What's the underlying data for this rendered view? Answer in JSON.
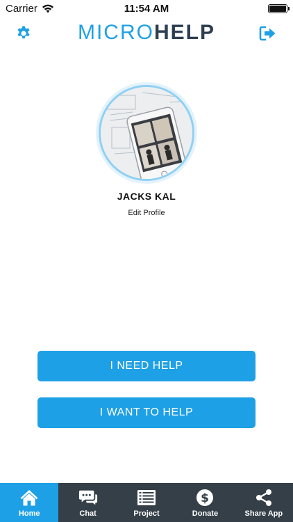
{
  "status_bar": {
    "carrier": "Carrier",
    "time": "11:54 AM",
    "battery_level": 1.0
  },
  "header": {
    "logo_part1": "MICRO",
    "logo_part2": "HELP",
    "left_icon": "gear-icon",
    "right_icon": "logout-icon"
  },
  "profile": {
    "name": "JACKS KAL",
    "edit_label": "Edit Profile"
  },
  "actions": {
    "need_help": "I NEED HELP",
    "want_help": "I WANT TO HELP"
  },
  "tabs": [
    {
      "label": "Home",
      "icon": "home-icon",
      "active": true
    },
    {
      "label": "Chat",
      "icon": "chat-icon",
      "active": false
    },
    {
      "label": "Project",
      "icon": "project-icon",
      "active": false
    },
    {
      "label": "Donate",
      "icon": "dollar-icon",
      "active": false
    },
    {
      "label": "Share App",
      "icon": "share-icon",
      "active": false
    }
  ],
  "colors": {
    "accent": "#1ea0e6",
    "tab_bar": "#343f47",
    "logo_dark": "#2c3e50"
  }
}
